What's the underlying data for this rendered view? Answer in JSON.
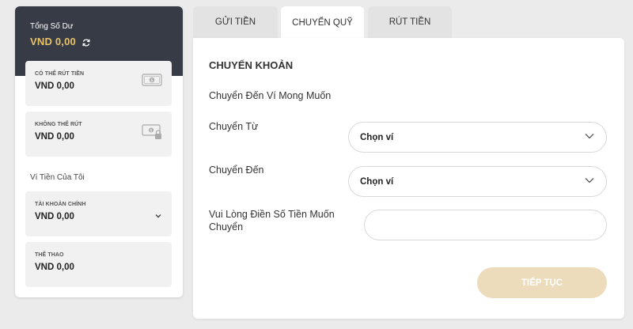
{
  "balance": {
    "title": "Tổng Số Dư",
    "value": "VND  0,00"
  },
  "cards": [
    {
      "label": "CÓ THỂ RÚT TIỀN",
      "value": "VND  0,00",
      "icon": "cash-icon"
    },
    {
      "label": "KHÔNG THỂ RÚT",
      "value": "VND  0,00",
      "icon": "cash-locked-icon"
    },
    {
      "label": "TÀI KHOẢN CHÍNH",
      "value": "VND  0,00",
      "icon": "chevron-down-icon"
    },
    {
      "label": "THỂ THAO",
      "value": "VND  0,00"
    }
  ],
  "wallets_section_label": "Ví Tiền Của Tôi",
  "tabs": [
    {
      "label": "GỬI TIỀN",
      "active": false
    },
    {
      "label": "CHUYỂN QUỸ",
      "active": true
    },
    {
      "label": "RÚT TIỀN",
      "active": false
    }
  ],
  "form": {
    "title": "CHUYỂN KHOẢN",
    "subtitle": "Chuyển Đến Ví Mong Muốn",
    "from_label": "Chuyển Từ",
    "from_value": "Chọn ví",
    "to_label": "Chuyển Đến",
    "to_value": "Chọn ví",
    "amount_label": "Vui Lòng Điền Số Tiền Muốn Chuyển",
    "amount_value": "",
    "submit_label": "TIẾP TỤC"
  },
  "colors": {
    "header_bg": "#373b46",
    "accent_gold": "#e8c26a",
    "button_disabled": "#ecdcbc"
  }
}
